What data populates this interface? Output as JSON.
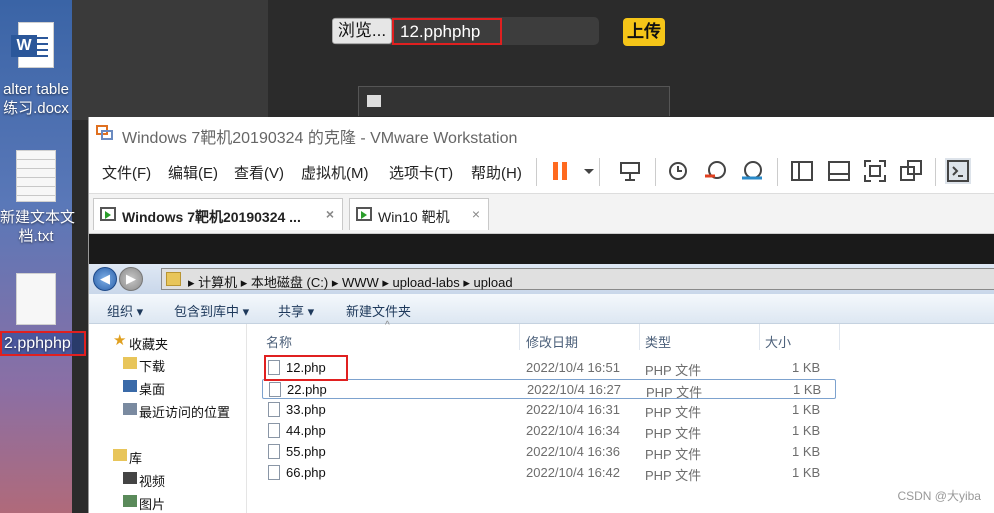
{
  "desktop": {
    "icons": [
      {
        "label_line1": "alter table",
        "label_line2": "练习.docx"
      },
      {
        "label_line1": "新建文本文",
        "label_line2": "档.txt"
      },
      {
        "label_line1": "2.pphphp"
      }
    ]
  },
  "upload_form": {
    "browse_label": "浏览...",
    "file_name": "12.pphphp",
    "upload_label": "上传"
  },
  "vmware": {
    "title": "Windows 7靶机20190324 的克隆 - VMware Workstation",
    "menu": [
      "文件(F)",
      "编辑(E)",
      "查看(V)",
      "虚拟机(M)",
      "选项卡(T)",
      "帮助(H)"
    ],
    "tabs": [
      {
        "label": "Windows 7靶机20190324 ...",
        "close": "×"
      },
      {
        "label": "Win10 靶机",
        "close": "×"
      }
    ],
    "colors": {
      "pause": "#ff6a1f",
      "accent": "#e02020"
    }
  },
  "explorer": {
    "breadcrumb": [
      "计算机",
      "本地磁盘 (C:)",
      "WWW",
      "upload-labs",
      "upload"
    ],
    "commands": [
      "组织 ▾",
      "包含到库中 ▾",
      "共享 ▾",
      "新建文件夹"
    ],
    "nav": [
      {
        "label": "收藏夹"
      },
      {
        "label": "下载"
      },
      {
        "label": "桌面"
      },
      {
        "label": "最近访问的位置"
      },
      {
        "label": "库"
      },
      {
        "label": "视频"
      },
      {
        "label": "图片"
      }
    ],
    "columns": [
      "名称",
      "修改日期",
      "类型",
      "大小"
    ],
    "files": [
      {
        "name": "12.php",
        "date": "2022/10/4 16:51",
        "type": "PHP 文件",
        "size": "1 KB"
      },
      {
        "name": "22.php",
        "date": "2022/10/4 16:27",
        "type": "PHP 文件",
        "size": "1 KB"
      },
      {
        "name": "33.php",
        "date": "2022/10/4 16:31",
        "type": "PHP 文件",
        "size": "1 KB"
      },
      {
        "name": "44.php",
        "date": "2022/10/4 16:34",
        "type": "PHP 文件",
        "size": "1 KB"
      },
      {
        "name": "55.php",
        "date": "2022/10/4 16:36",
        "type": "PHP 文件",
        "size": "1 KB"
      },
      {
        "name": "66.php",
        "date": "2022/10/4 16:42",
        "type": "PHP 文件",
        "size": "1 KB"
      }
    ]
  },
  "watermark": "CSDN @大yiba"
}
